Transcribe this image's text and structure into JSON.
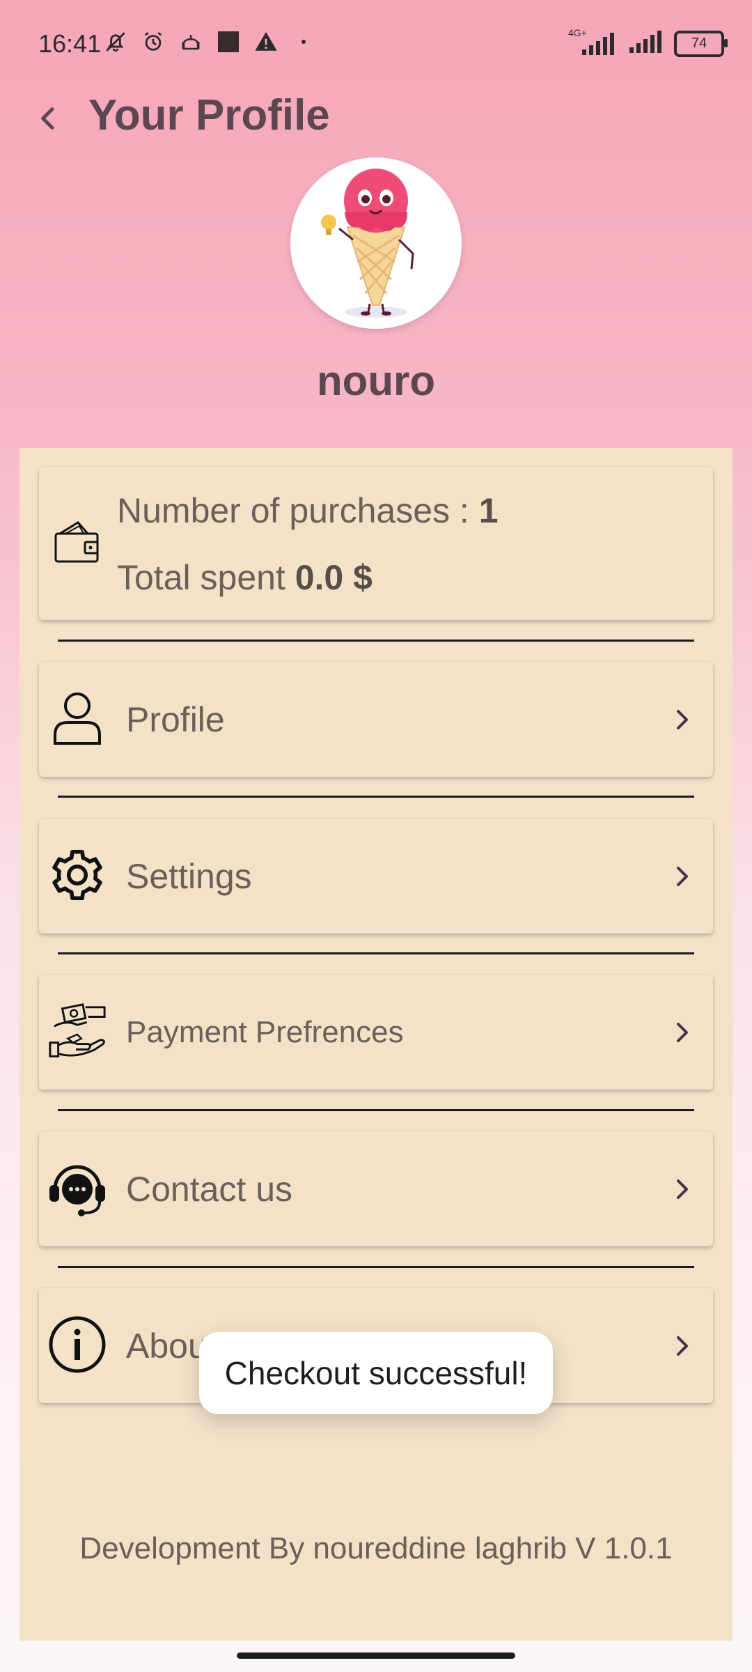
{
  "status_bar": {
    "time": "16:41",
    "network": "4G+",
    "battery": "74"
  },
  "appbar": {
    "title": "Your Profile"
  },
  "user": {
    "name": "nouro"
  },
  "stats": {
    "purchases_label": "Number of purchases : ",
    "purchases_value": "1",
    "spent_label": "Total spent ",
    "spent_value": "0.0 $"
  },
  "menu": {
    "profile": "Profile",
    "settings": "Settings",
    "payment": "Payment Prefrences",
    "contact": "Contact us",
    "about": "About"
  },
  "toast": {
    "message": "Checkout successful!"
  },
  "footer": {
    "text": "Development By noureddine laghrib V 1.0.1"
  },
  "colors": {
    "gradient_top": "#f5a6b8",
    "panel": "#f3e2c8",
    "text_primary": "#5c4650",
    "text_secondary": "#6b5f57",
    "chevron": "#4a2e4a",
    "toast_bg": "#ffffff"
  },
  "icons": {
    "back": "arrow-back-icon",
    "stats": "wallet-icon",
    "profile": "person-icon",
    "settings": "gear-icon",
    "payment": "hands-money-icon",
    "contact": "support-chat-icon",
    "about": "info-icon",
    "chevron": "chevron-right-icon"
  }
}
